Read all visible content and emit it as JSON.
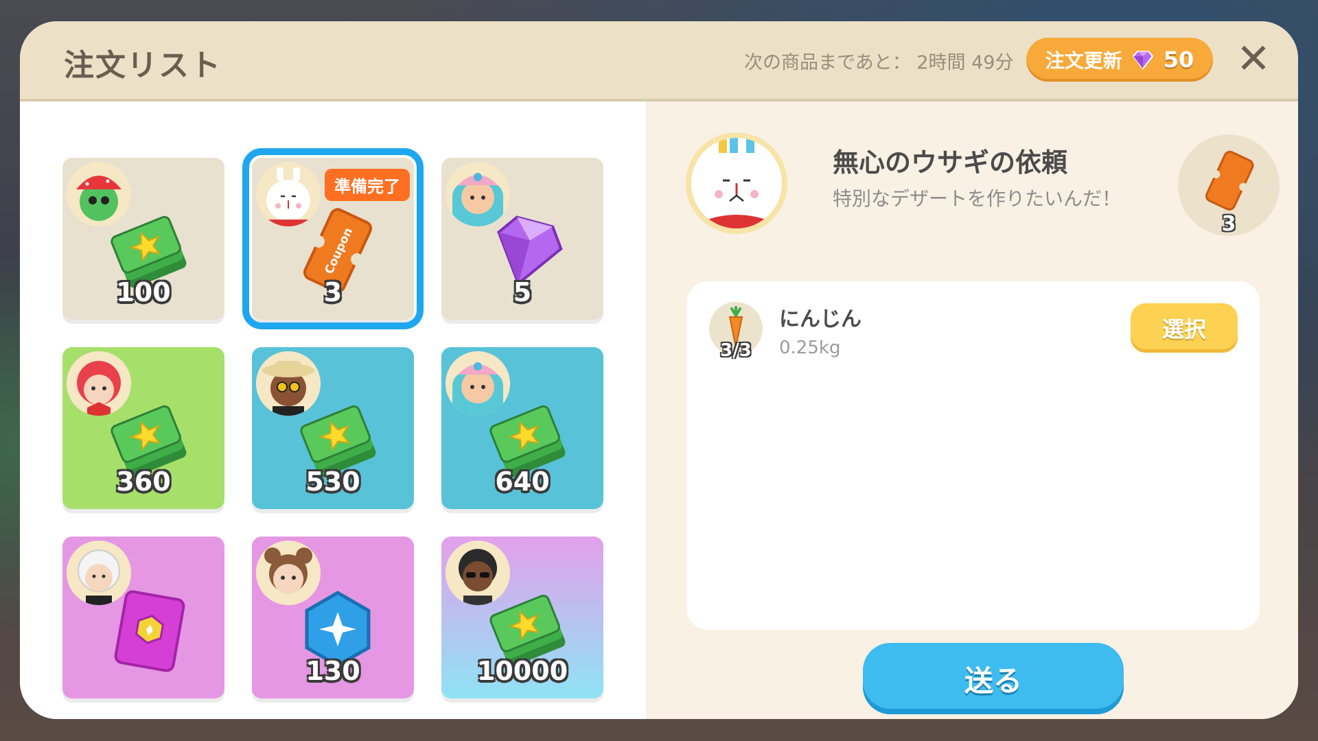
{
  "header": {
    "title": "注文リスト",
    "timer_label": "次の商品まであと：",
    "timer_value": "2時間 49分",
    "refresh_label": "注文更新",
    "refresh_cost": "50",
    "close_symbol": "✕"
  },
  "orders": [
    {
      "amount": "100",
      "reward_icon": "cash-icon",
      "bg": "beige"
    },
    {
      "amount": "3",
      "reward_icon": "coupon-icon",
      "bg": "beige",
      "badge": "準備完了",
      "selected": true
    },
    {
      "amount": "5",
      "reward_icon": "gem-icon",
      "bg": "beige"
    },
    {
      "amount": "360",
      "reward_icon": "cash-icon",
      "bg": "green"
    },
    {
      "amount": "530",
      "reward_icon": "cash-icon",
      "bg": "teal"
    },
    {
      "amount": "640",
      "reward_icon": "cash-icon",
      "bg": "teal"
    },
    {
      "amount": "",
      "reward_icon": "gift-pack-icon",
      "bg": "pink"
    },
    {
      "amount": "130",
      "reward_icon": "blue-hex-gem-icon",
      "bg": "pink"
    },
    {
      "amount": "10000",
      "reward_icon": "cash-icon",
      "bg": "gradient"
    }
  ],
  "request": {
    "title": "無心のウサギの依頼",
    "subtitle": "特別なデザートを作りたいんだ！",
    "reward_count": "3",
    "reward_icon": "coupon-icon",
    "coupon_text": "Coupon",
    "items": [
      {
        "name": "にんじん",
        "weight": "0.25kg",
        "count": "3/3",
        "icon": "carrot-icon",
        "select_label": "選択"
      }
    ],
    "send_label": "送る"
  },
  "colors": {
    "header_bg": "#ece0c6",
    "accent_orange": "#f7a93a",
    "send_blue": "#3ebcf0",
    "select_yellow": "#fdd152",
    "selected_outline": "#1ea7ef",
    "ready_badge": "#ff6f21"
  }
}
